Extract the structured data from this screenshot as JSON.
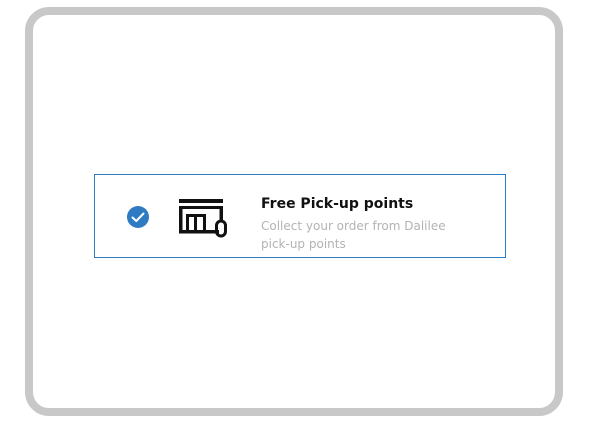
{
  "delivery_option": {
    "title": "Free Pick-up points",
    "description_line1": "Collect your order from Dalilee",
    "description_line2": "pick-up points",
    "selected": true,
    "icons": {
      "check": "check-circle-icon",
      "store": "storefront-icon"
    }
  },
  "colors": {
    "accent": "#2e7bc4",
    "frame": "#c8c8c8",
    "title": "#111111",
    "description": "#b3b3b3"
  }
}
